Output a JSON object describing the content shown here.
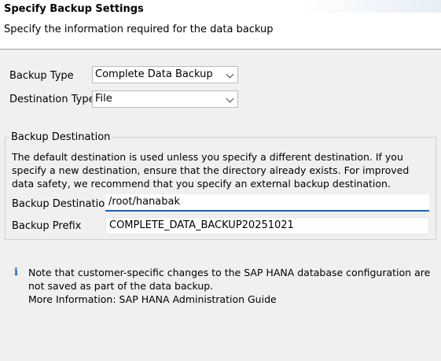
{
  "header": {
    "title": "Specify Backup Settings",
    "description": "Specify the information required for the data backup"
  },
  "form": {
    "backup_type_label": "Backup Type",
    "backup_type_value": "Complete Data Backup",
    "destination_type_label": "Destination Type",
    "destination_type_value": "File"
  },
  "destination_group": {
    "title": "Backup Destination",
    "description": "The default destination is used unless you specify a different destination. If you specify a new destination, ensure that the directory already exists. For improved data safety, we recommend that you specify an external backup destination.",
    "destination_label": "Backup Destination",
    "destination_value": "/root/hanabak",
    "prefix_label": "Backup Prefix",
    "prefix_value": "COMPLETE_DATA_BACKUP20251021"
  },
  "info": {
    "icon": "info-icon",
    "note": "Note that customer-specific changes to the SAP HANA database configuration are not saved as part of the data backup.",
    "more_info": "More Information: SAP HANA Administration Guide"
  }
}
